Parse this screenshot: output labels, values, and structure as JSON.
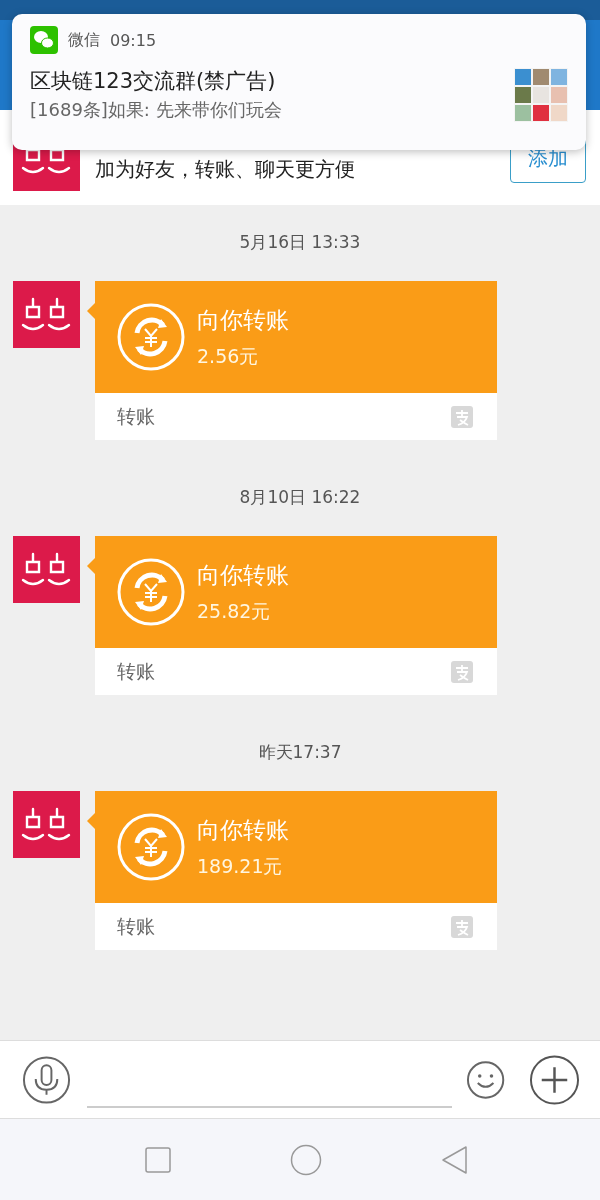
{
  "notification": {
    "app": "微信",
    "time": "09:15",
    "title": "区块链123交流群(禁广告)",
    "message": "[1689条]如果: 先来带你们玩会"
  },
  "banner": {
    "text": "加为好友，转账、聊天更方便",
    "button": "添加"
  },
  "messages": [
    {
      "timestamp": "5月16日 13:33",
      "title": "向你转账",
      "amount": "2.56元",
      "footer": "转账"
    },
    {
      "timestamp": "8月10日 16:22",
      "title": "向你转账",
      "amount": "25.82元",
      "footer": "转账"
    },
    {
      "timestamp": "昨天17:37",
      "title": "向你转账",
      "amount": "189.21元",
      "footer": "转账"
    }
  ]
}
